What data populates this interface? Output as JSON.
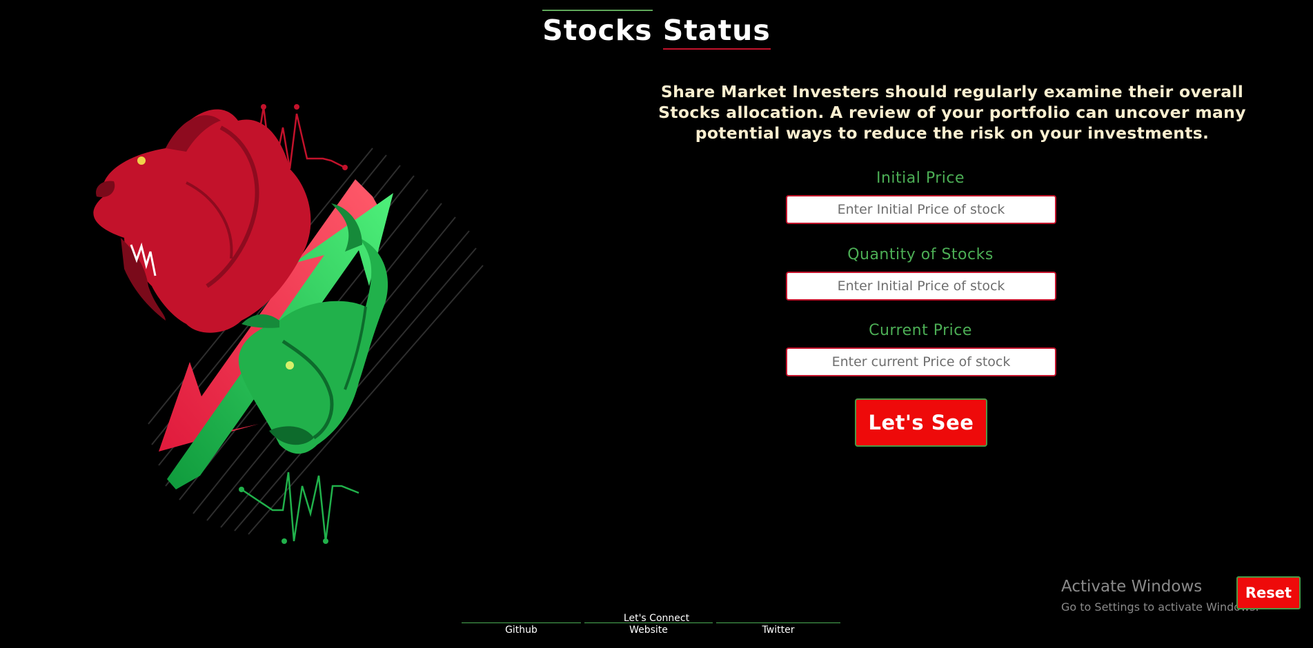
{
  "header": {
    "title_word_1": "Stocks",
    "title_word_2": "Status"
  },
  "intro": {
    "line_1": "Share Market Investers should regularly examine their overall",
    "line_2": "Stocks allocation. A review of your portfolio can uncover many",
    "line_3": "potential ways to reduce the risk on your investments."
  },
  "form": {
    "initial_price": {
      "label": "Initial Price",
      "placeholder": "Enter Initial Price of stock",
      "value": ""
    },
    "quantity": {
      "label": "Quantity of Stocks",
      "placeholder": "Enter Initial Price of stock",
      "value": ""
    },
    "current_price": {
      "label": "Current Price",
      "placeholder": "Enter current Price of stock",
      "value": ""
    },
    "submit_label": "Let's See"
  },
  "footer": {
    "connect_label": "Let's Connect",
    "links": [
      {
        "label": "Github"
      },
      {
        "label": "Website"
      },
      {
        "label": "Twitter"
      }
    ]
  },
  "windows_watermark": {
    "title": "Activate Windows",
    "subtitle": "Go to Settings to activate Windows."
  },
  "reset_label": "Reset",
  "colors": {
    "background": "#000000",
    "accent_red": "#ee0a0a",
    "accent_green": "#4cae55",
    "intro_text": "#fbefd0",
    "bear": "#c3122b",
    "bull": "#21b14b"
  },
  "illustration": {
    "subject": "bear-vs-bull-stock-market-illustration"
  }
}
